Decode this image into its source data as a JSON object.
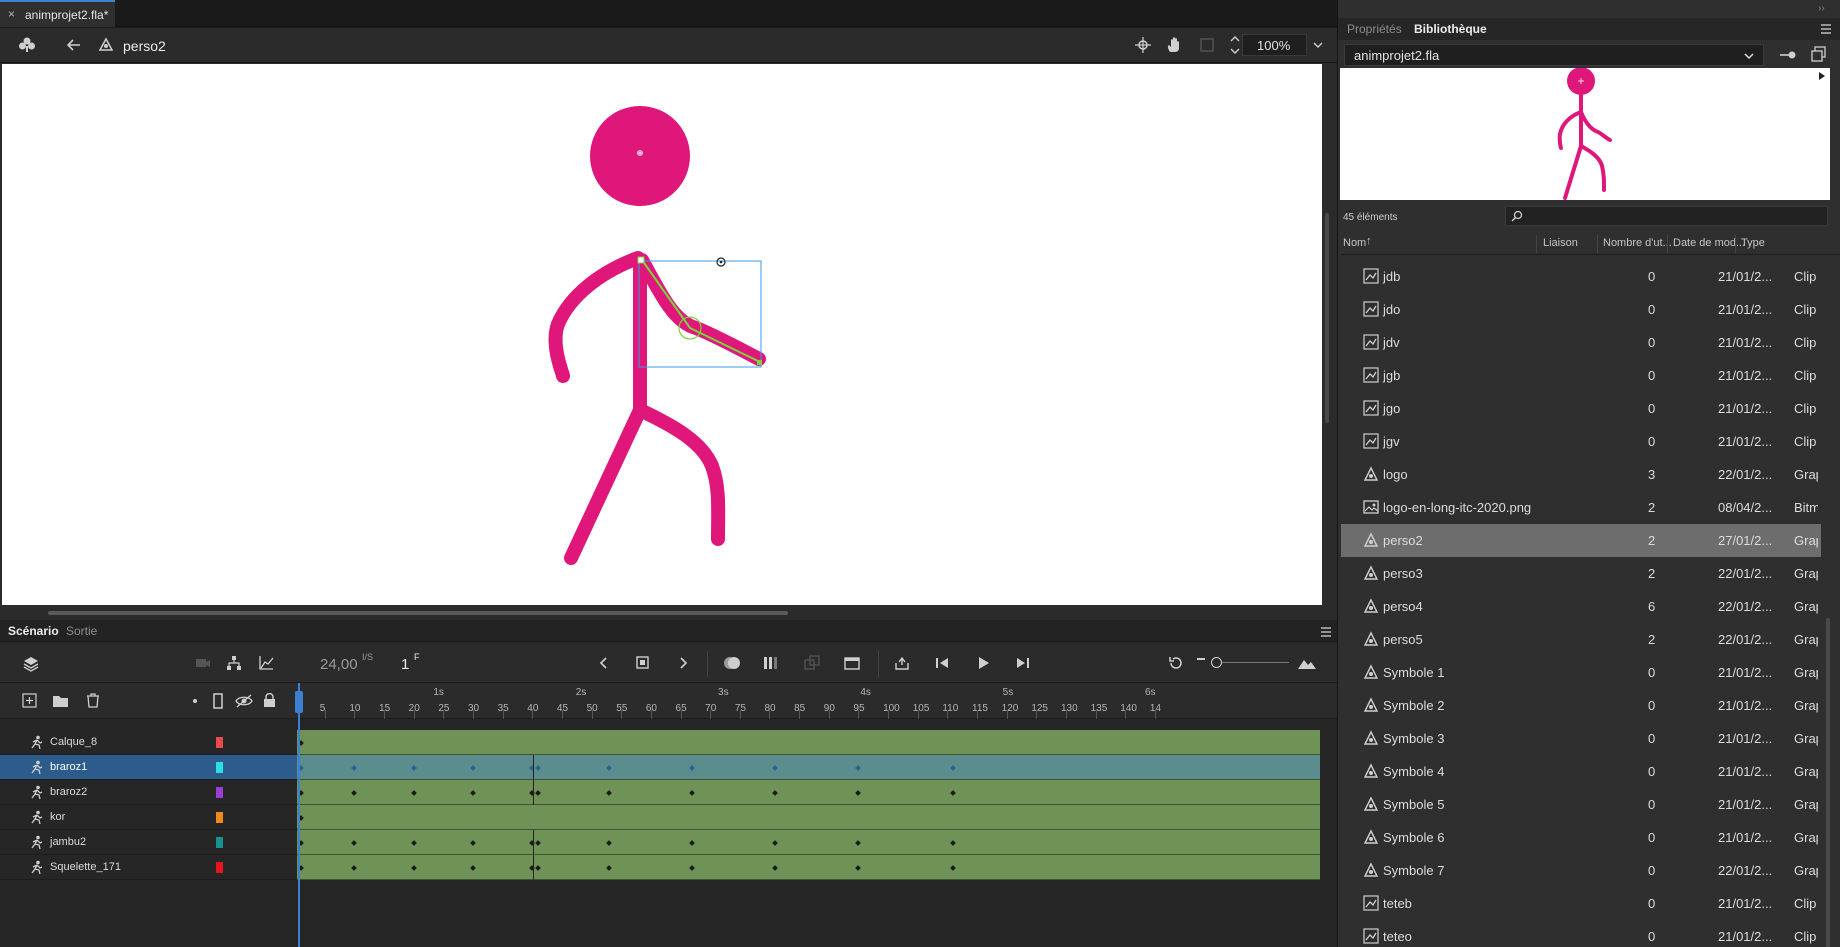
{
  "document": {
    "tab_title": "animprojet2.fla*",
    "close_icon": "×"
  },
  "editbar": {
    "symbol_name": "perso2",
    "zoom": "100%"
  },
  "panel": {
    "tabs": [
      "Propriétés",
      "Bibliothèque"
    ],
    "library_name": "animprojet2.fla",
    "item_count": "45 éléments",
    "columns": [
      "Nom",
      "Liaison",
      "Nombre d'ut...",
      "Date de mod...",
      "Type"
    ],
    "items": [
      {
        "name": "jdb",
        "icon": "movie-clip-icon",
        "uses": "0",
        "date": "21/01/2...",
        "type": "Clip"
      },
      {
        "name": "jdo",
        "icon": "movie-clip-icon",
        "uses": "0",
        "date": "21/01/2...",
        "type": "Clip"
      },
      {
        "name": "jdv",
        "icon": "movie-clip-icon",
        "uses": "0",
        "date": "21/01/2...",
        "type": "Clip"
      },
      {
        "name": "jgb",
        "icon": "movie-clip-icon",
        "uses": "0",
        "date": "21/01/2...",
        "type": "Clip"
      },
      {
        "name": "jgo",
        "icon": "movie-clip-icon",
        "uses": "0",
        "date": "21/01/2...",
        "type": "Clip"
      },
      {
        "name": "jgv",
        "icon": "movie-clip-icon",
        "uses": "0",
        "date": "21/01/2...",
        "type": "Clip"
      },
      {
        "name": "logo",
        "icon": "graphic-icon",
        "uses": "3",
        "date": "22/01/2...",
        "type": "Graphique"
      },
      {
        "name": "logo-en-long-itc-2020.png",
        "icon": "bitmap-icon",
        "uses": "2",
        "date": "08/04/2...",
        "type": "Bitmap"
      },
      {
        "name": "perso2",
        "icon": "graphic-icon",
        "uses": "2",
        "date": "27/01/2...",
        "type": "Graphique"
      },
      {
        "name": "perso3",
        "icon": "graphic-icon",
        "uses": "2",
        "date": "22/01/2...",
        "type": "Graphique"
      },
      {
        "name": "perso4",
        "icon": "graphic-icon",
        "uses": "6",
        "date": "22/01/2...",
        "type": "Graphique"
      },
      {
        "name": "perso5",
        "icon": "graphic-icon",
        "uses": "2",
        "date": "22/01/2...",
        "type": "Graphique"
      },
      {
        "name": "Symbole 1",
        "icon": "graphic-icon",
        "uses": "0",
        "date": "21/01/2...",
        "type": "Graphique"
      },
      {
        "name": "Symbole 2",
        "icon": "graphic-icon",
        "uses": "0",
        "date": "21/01/2...",
        "type": "Graphique"
      },
      {
        "name": "Symbole 3",
        "icon": "graphic-icon",
        "uses": "0",
        "date": "21/01/2...",
        "type": "Graphique"
      },
      {
        "name": "Symbole 4",
        "icon": "graphic-icon",
        "uses": "0",
        "date": "21/01/2...",
        "type": "Graphique"
      },
      {
        "name": "Symbole 5",
        "icon": "graphic-icon",
        "uses": "0",
        "date": "21/01/2...",
        "type": "Graphique"
      },
      {
        "name": "Symbole 6",
        "icon": "graphic-icon",
        "uses": "0",
        "date": "21/01/2...",
        "type": "Graphique"
      },
      {
        "name": "Symbole 7",
        "icon": "graphic-icon",
        "uses": "0",
        "date": "22/01/2...",
        "type": "Graphique"
      },
      {
        "name": "teteb",
        "icon": "movie-clip-icon",
        "uses": "0",
        "date": "21/01/2...",
        "type": "Clip"
      },
      {
        "name": "teteo",
        "icon": "movie-clip-icon",
        "uses": "0",
        "date": "21/01/2...",
        "type": "Clip"
      }
    ],
    "selected_item": "perso2"
  },
  "timeline": {
    "tabs": [
      "Scénario",
      "Sortie"
    ],
    "fps": "24,00",
    "fps_unit": "I/S",
    "current_frame": "1",
    "frame_unit": "F",
    "seconds": [
      "1s",
      "2s",
      "3s",
      "4s",
      "5s",
      "6s"
    ],
    "frame_ticks": [
      "5",
      "10",
      "15",
      "20",
      "25",
      "30",
      "35",
      "40",
      "45",
      "50",
      "55",
      "60",
      "65",
      "70",
      "75",
      "80",
      "85",
      "90",
      "95",
      "100",
      "105",
      "110",
      "115",
      "120",
      "125",
      "130",
      "135",
      "140",
      "14"
    ],
    "layers": [
      {
        "name": "Calque_8",
        "color": "#e84b4b",
        "keys": [
          1
        ]
      },
      {
        "name": "braroz1",
        "color": "#27e0e8",
        "keys": [
          1,
          10,
          20,
          30,
          40,
          41,
          53,
          67,
          81,
          95,
          111
        ]
      },
      {
        "name": "braroz2",
        "color": "#9a3fd1",
        "keys": [
          1,
          10,
          20,
          30,
          40,
          41,
          53,
          67,
          81,
          95,
          111
        ]
      },
      {
        "name": "kor",
        "color": "#f08a1c",
        "keys": [
          1
        ]
      },
      {
        "name": "jambu2",
        "color": "#16928f",
        "keys": [
          1,
          10,
          20,
          30,
          40,
          41,
          53,
          67,
          81,
          95,
          111
        ]
      },
      {
        "name": "Squelette_171",
        "color": "#e8141e",
        "keys": [
          1,
          10,
          20,
          30,
          40,
          41,
          53,
          67,
          81,
          95,
          111
        ]
      }
    ],
    "selected_layer": "braroz1"
  },
  "colors": {
    "accent": "#3d7fd1",
    "figure": "#e0177a",
    "bone": "#7ad63b"
  }
}
